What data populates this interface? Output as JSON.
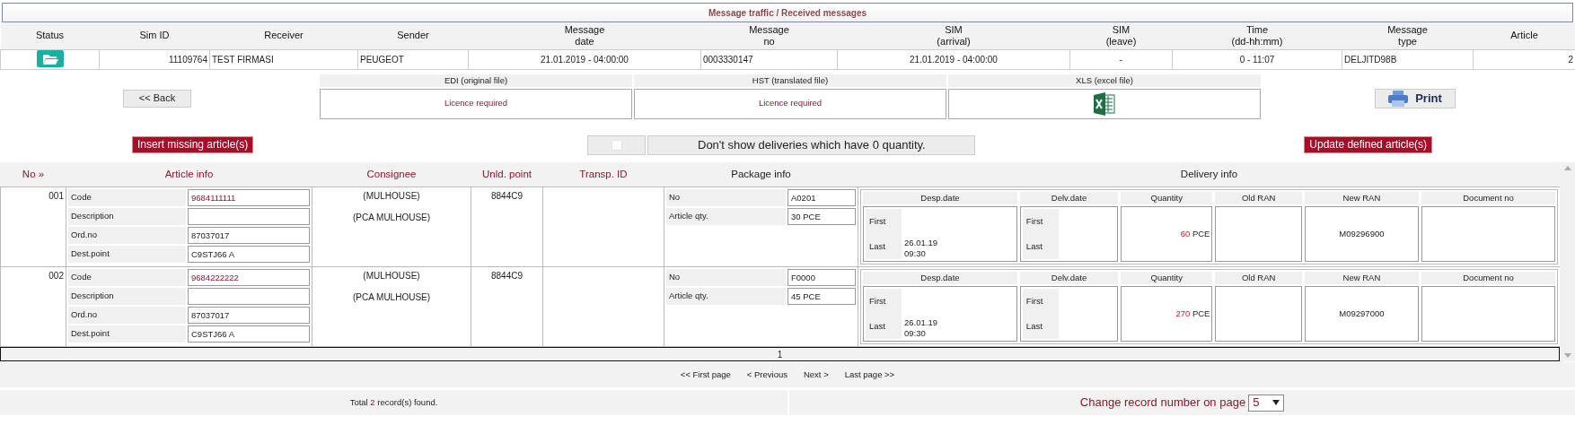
{
  "title": "Message traffic / Received messages",
  "message_table": {
    "columns": [
      [
        "Status"
      ],
      [
        "Sim ID"
      ],
      [
        "Receiver"
      ],
      [
        "Sender"
      ],
      [
        "Message",
        "date"
      ],
      [
        "Message",
        "no"
      ],
      [
        "SIM",
        "(arrival)"
      ],
      [
        "SIM",
        "(leave)"
      ],
      [
        "Time",
        "(dd-hh:mm)"
      ],
      [
        "Message",
        "type"
      ],
      [
        "Article"
      ]
    ],
    "cells": [
      {
        "kind": "icon"
      },
      {
        "kind": "text",
        "text": "11109764"
      },
      {
        "kind": "text",
        "text": "TEST FIRMASI"
      },
      {
        "kind": "text",
        "text": "PEUGEOT"
      },
      {
        "kind": "text",
        "text": "21.01.2019 - 04:00:00"
      },
      {
        "kind": "text",
        "text": "0003330147"
      },
      {
        "kind": "text",
        "text": "21.01.2019 - 04:00:00"
      },
      {
        "kind": "text",
        "text": "-"
      },
      {
        "kind": "text",
        "text": "0 - 11:07"
      },
      {
        "kind": "text",
        "text": "DELJITD98B"
      },
      {
        "kind": "text",
        "text": "2"
      }
    ]
  },
  "back_button": "<< Back",
  "files": [
    {
      "label": "EDI (original file)",
      "kind": "text",
      "text": "Licence required"
    },
    {
      "label": "HST (translated file)",
      "kind": "text",
      "text": "Licence required"
    },
    {
      "label": "XLS (excel file)",
      "kind": "icon"
    }
  ],
  "print_button": "Print",
  "insert_button": "Insert missing article(s)",
  "zero_filter": {
    "checked": false,
    "label": "Don't show deliveries which have 0 quantity."
  },
  "update_button": "Update defined article(s)",
  "articles_table": {
    "columns": [
      {
        "label": "No »",
        "sortable": true
      },
      {
        "label": "Article info",
        "sortable": true
      },
      {
        "label": "Consignee",
        "sortable": true
      },
      {
        "label": "Unld. point",
        "sortable": true
      },
      {
        "label": "Transp. ID",
        "sortable": true
      },
      {
        "label": "Package info",
        "sortable": false
      },
      {
        "label": "Delivery info",
        "sortable": false
      }
    ],
    "rows": [
      {
        "no": "001",
        "article_fields": [
          {
            "label": "Code",
            "value": "9684111111",
            "highlight": true
          },
          {
            "label": "Description"
          },
          {
            "label": "Ord.no",
            "value": "87037017",
            "highlight": false
          },
          {
            "label": "Dest.point",
            "value": "C9STJ66 A",
            "highlight": false
          }
        ],
        "consignee": [
          "(MULHOUSE)",
          "(PCA MULHOUSE)"
        ],
        "unloading_point": "8844C9",
        "package_fields": [
          {
            "label": "No",
            "value": "A0201"
          },
          {
            "label": "Article qty.",
            "value": "30 PCE"
          }
        ],
        "delivery": {
          "columns": [
            "Desp.date",
            "Delv.date",
            "Quantity",
            "Old RAN",
            "New RAN",
            "Document no"
          ],
          "desp": [
            {
              "label": "First"
            },
            {
              "label": "Last",
              "lines": [
                "26.01.19",
                "09:30"
              ]
            }
          ],
          "delv": [
            {
              "label": "First"
            },
            {
              "label": "Last"
            }
          ],
          "quantity": "60",
          "unit": "PCE",
          "new_ran": "M09296900"
        }
      },
      {
        "no": "002",
        "article_fields": [
          {
            "label": "Code",
            "value": "9684222222",
            "highlight": true
          },
          {
            "label": "Description"
          },
          {
            "label": "Ord.no",
            "value": "87037017",
            "highlight": false
          },
          {
            "label": "Dest.point",
            "value": "C9STJ66 A",
            "highlight": false
          }
        ],
        "consignee": [
          "(MULHOUSE)",
          "(PCA MULHOUSE)"
        ],
        "unloading_point": "8844C9",
        "package_fields": [
          {
            "label": "No",
            "value": "F0000"
          },
          {
            "label": "Article qty.",
            "value": "45 PCE"
          }
        ],
        "delivery": {
          "columns": [
            "Desp.date",
            "Delv.date",
            "Quantity",
            "Old RAN",
            "New RAN",
            "Document no"
          ],
          "desp": [
            {
              "label": "First"
            },
            {
              "label": "Last",
              "lines": [
                "26.01.19",
                "09:30"
              ]
            }
          ],
          "delv": [
            {
              "label": "First"
            },
            {
              "label": "Last"
            }
          ],
          "quantity": "270",
          "unit": "PCE",
          "new_ran": "M09297000"
        }
      }
    ],
    "page_indicator": "1"
  },
  "pager": [
    "<< First page",
    "< Previous",
    "Next >",
    "Last page >>"
  ],
  "total": {
    "before": "Total",
    "count": "2",
    "after": "record(s) found."
  },
  "record_count": {
    "label": "Change record number on page",
    "value": "5"
  }
}
